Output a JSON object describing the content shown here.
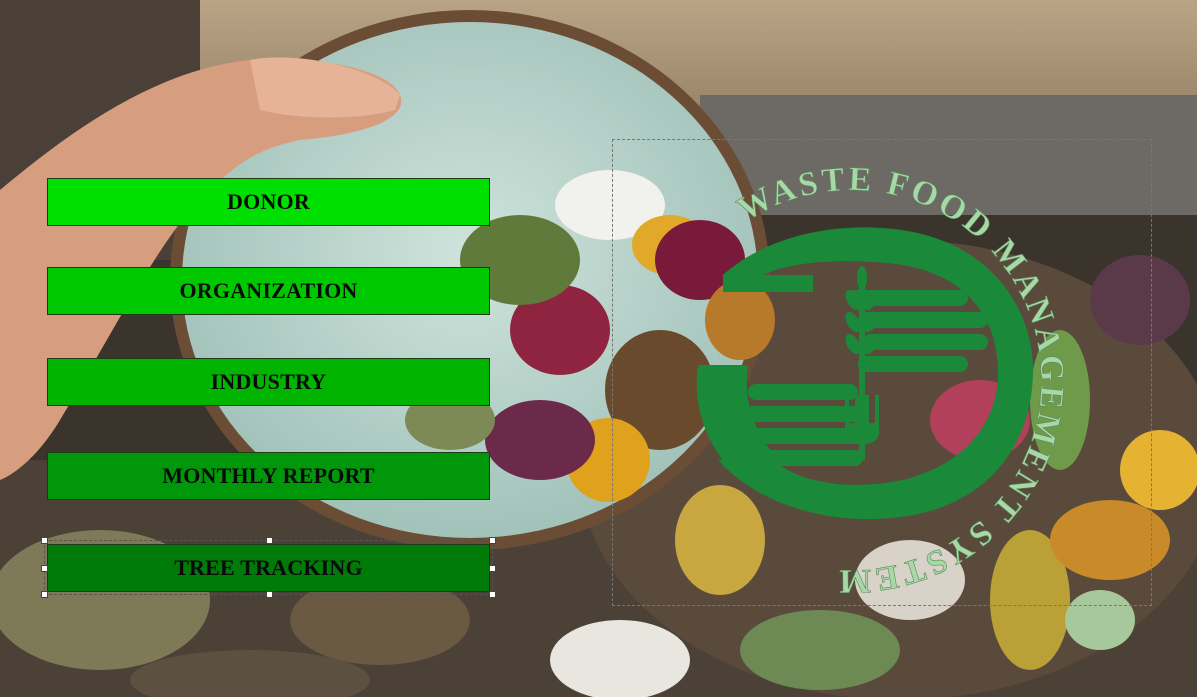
{
  "colors": {
    "donor_bg": "#00e000",
    "organization_bg": "#00c800",
    "industry_bg": "#00b400",
    "monthly_report_bg": "#00980a",
    "tree_tracking_bg": "#007a08",
    "logo_green": "#1a8a3a",
    "logo_text": "#a6d8a8"
  },
  "menu": {
    "donor": "DONOR",
    "organization": "ORGANIZATION",
    "industry": "INDUSTRY",
    "monthly_report": "MONTHLY REPORT",
    "tree_tracking": "TREE TRACKING"
  },
  "logo": {
    "ring_text": "WASTE FOOD MANAGEMENT SYSTEM",
    "icon": "hands-wheat-fork-icon"
  },
  "background": {
    "icon": "food-waste-photo"
  }
}
